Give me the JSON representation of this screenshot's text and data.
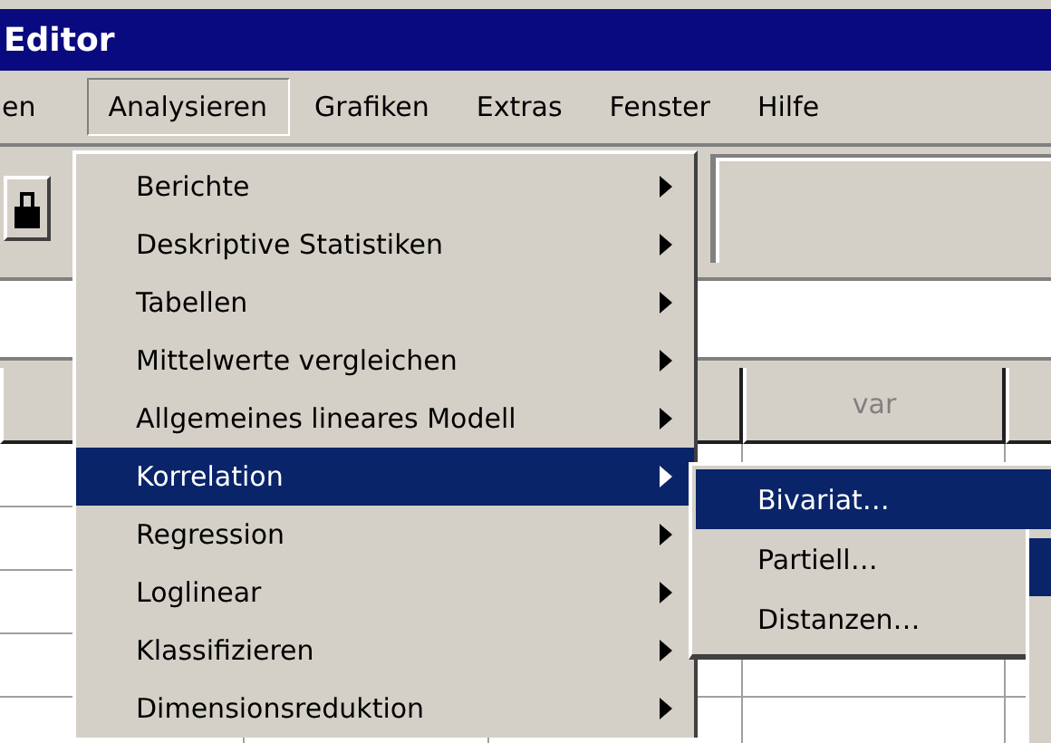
{
  "window": {
    "title": "Editor"
  },
  "menubar": [
    {
      "label": "en",
      "selected": false
    },
    {
      "label": "Analysieren",
      "selected": true
    },
    {
      "label": "Grafiken",
      "selected": false
    },
    {
      "label": "Extras",
      "selected": false
    },
    {
      "label": "Fenster",
      "selected": false
    },
    {
      "label": "Hilfe",
      "selected": false
    }
  ],
  "grid": {
    "columns": [
      "var"
    ]
  },
  "menu": {
    "items": [
      {
        "label": "Berichte",
        "submenu": true,
        "selected": false
      },
      {
        "label": "Deskriptive Statistiken",
        "submenu": true,
        "selected": false
      },
      {
        "label": "Tabellen",
        "submenu": true,
        "selected": false
      },
      {
        "label": "Mittelwerte vergleichen",
        "submenu": true,
        "selected": false
      },
      {
        "label": "Allgemeines lineares Modell",
        "submenu": true,
        "selected": false
      },
      {
        "label": "Korrelation",
        "submenu": true,
        "selected": true
      },
      {
        "label": "Regression",
        "submenu": true,
        "selected": false
      },
      {
        "label": "Loglinear",
        "submenu": true,
        "selected": false
      },
      {
        "label": "Klassifizieren",
        "submenu": true,
        "selected": false
      },
      {
        "label": "Dimensionsreduktion",
        "submenu": true,
        "selected": false
      }
    ]
  },
  "submenu": {
    "items": [
      {
        "label": "Bivariat…",
        "selected": true
      },
      {
        "label": "Partiell…",
        "selected": false
      },
      {
        "label": "Distanzen…",
        "selected": false
      }
    ]
  }
}
